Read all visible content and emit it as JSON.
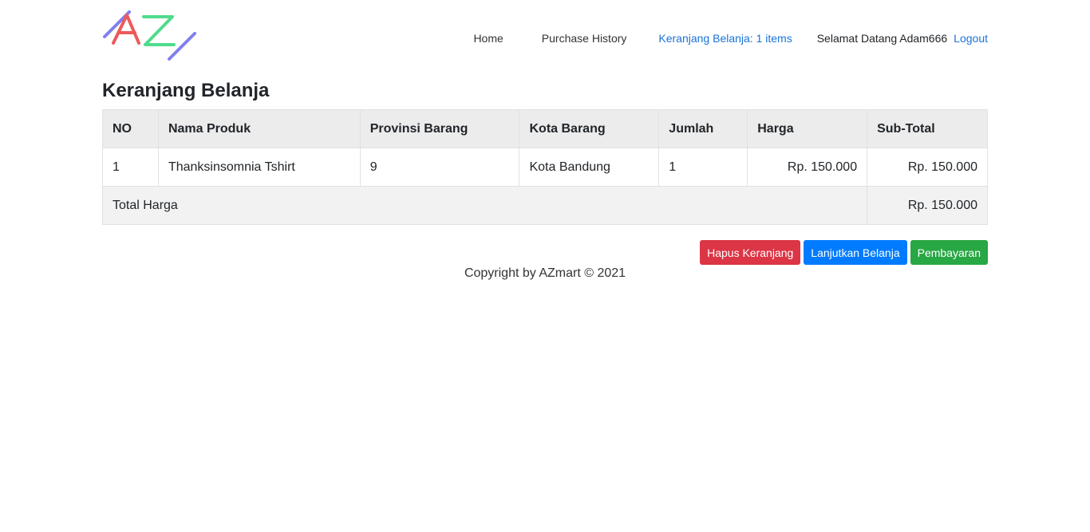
{
  "nav": {
    "logo_text": "AZ",
    "home": "Home",
    "purchase_history": "Purchase History",
    "cart": "Keranjang Belanja: 1 items",
    "welcome": "Selamat Datang Adam666",
    "logout": "Logout"
  },
  "page_title": "Keranjang Belanja",
  "table": {
    "headers": [
      "NO",
      "Nama Produk",
      "Provinsi Barang",
      "Kota Barang",
      "Jumlah",
      "Harga",
      "Sub-Total"
    ],
    "rows": [
      [
        "1",
        "Thanksinsomnia Tshirt",
        "9",
        "Kota Bandung",
        "1",
        "Rp. 150.000",
        "Rp. 150.000"
      ]
    ],
    "total_label": "Total Harga",
    "total_value": "Rp. 150.000"
  },
  "buttons": {
    "clear_cart": "Hapus Keranjang",
    "continue_shopping": "Lanjutkan Belanja",
    "checkout": "Pembayaran"
  },
  "footer": "Copyright by AZmart © 2021",
  "colors": {
    "logo_a": "#ee5a5a",
    "logo_z": "#4fdc8c",
    "logo_lines": "#8080f0",
    "link": "#1a73d9",
    "danger": "#dc3545",
    "primary": "#007bff",
    "success": "#28a745"
  }
}
